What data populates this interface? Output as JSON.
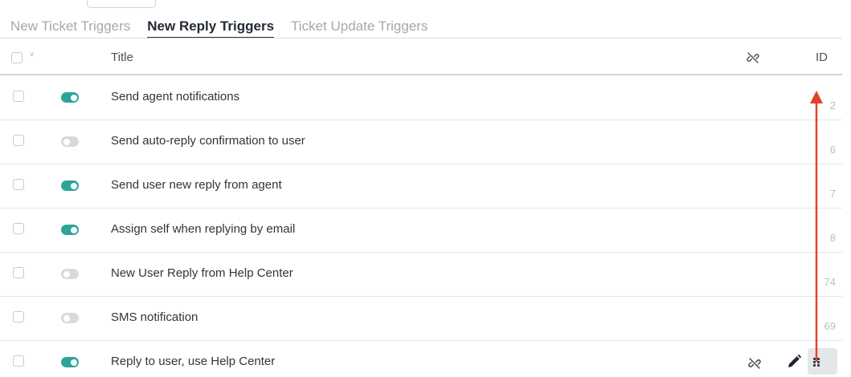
{
  "tabs": [
    {
      "label": "New Ticket Triggers",
      "active": false
    },
    {
      "label": "New Reply Triggers",
      "active": true
    },
    {
      "label": "Ticket Update Triggers",
      "active": false
    }
  ],
  "table": {
    "header": {
      "title": "Title",
      "id": "ID",
      "unlink_icon": "unlink-icon",
      "select_caret": "˅"
    },
    "rows": [
      {
        "enabled": true,
        "title": "Send agent notifications",
        "id": "2"
      },
      {
        "enabled": false,
        "title": "Send auto-reply confirmation to user",
        "id": "6"
      },
      {
        "enabled": true,
        "title": "Send user new reply from agent",
        "id": "7"
      },
      {
        "enabled": true,
        "title": "Assign self when replying by email",
        "id": "8"
      },
      {
        "enabled": false,
        "title": "New User Reply from Help Center",
        "id": "74"
      },
      {
        "enabled": false,
        "title": "SMS notification",
        "id": "69"
      },
      {
        "enabled": true,
        "title": "Reply to user, use Help Center",
        "id": ""
      }
    ],
    "hovered_row_actions": [
      "unlink-icon",
      "pencil-icon",
      "drag-handle-icon"
    ]
  },
  "colors": {
    "toggle_on": "#2ea39a",
    "toggle_off": "#d7dadd",
    "annotation_arrow": "#e0432b"
  }
}
